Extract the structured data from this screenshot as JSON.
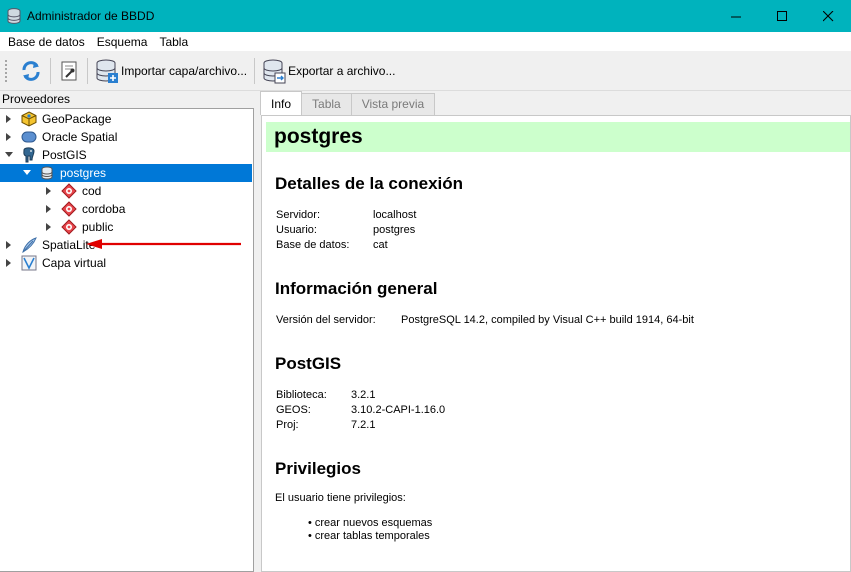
{
  "window": {
    "title": "Administrador de BBDD"
  },
  "menu": [
    {
      "label": "Base de datos"
    },
    {
      "label": "Esquema"
    },
    {
      "label": "Tabla"
    }
  ],
  "toolbar": {
    "refresh_icon": "refresh-icon",
    "info_icon": "properties-icon",
    "import_label": "Importar capa/archivo...",
    "export_label": "Exportar a archivo..."
  },
  "providers": {
    "header": "Proveedores",
    "items": [
      {
        "label": "GeoPackage",
        "icon": "geopackage-icon",
        "expanded": false
      },
      {
        "label": "Oracle Spatial",
        "icon": "oracle-icon",
        "expanded": false
      },
      {
        "label": "PostGIS",
        "icon": "postgis-elephant-icon",
        "expanded": true
      },
      {
        "label": "postgres",
        "icon": "database-icon",
        "expanded": true,
        "selected": true
      },
      {
        "label": "cod",
        "icon": "schema-icon",
        "expanded": false
      },
      {
        "label": "cordoba",
        "icon": "schema-icon",
        "expanded": false
      },
      {
        "label": "public",
        "icon": "schema-icon",
        "expanded": false
      },
      {
        "label": "SpatiaLite",
        "icon": "spatialite-icon",
        "expanded": false
      },
      {
        "label": "Capa virtual",
        "icon": "virtual-layer-icon",
        "expanded": false
      }
    ]
  },
  "tabs": [
    {
      "label": "Info",
      "active": true
    },
    {
      "label": "Tabla",
      "active": false
    },
    {
      "label": "Vista previa",
      "active": false
    }
  ],
  "info": {
    "title": "postgres",
    "connection": {
      "heading": "Detalles de la conexión",
      "rows": [
        {
          "key": "Servidor:",
          "value": "localhost"
        },
        {
          "key": "Usuario:",
          "value": "postgres"
        },
        {
          "key": "Base de datos:",
          "value": "cat"
        }
      ]
    },
    "general": {
      "heading": "Información general",
      "rows": [
        {
          "key": "Versión del servidor:",
          "value": "PostgreSQL 14.2, compiled by Visual C++ build 1914, 64-bit"
        }
      ]
    },
    "postgis": {
      "heading": "PostGIS",
      "rows": [
        {
          "key": "Biblioteca:",
          "value": "3.2.1"
        },
        {
          "key": "GEOS:",
          "value": "3.10.2-CAPI-1.16.0"
        },
        {
          "key": "Proj:",
          "value": "7.2.1"
        }
      ]
    },
    "privileges": {
      "heading": "Privilegios",
      "intro": "El usuario tiene privilegios:",
      "items": [
        "crear nuevos esquemas",
        "crear tablas temporales"
      ]
    }
  },
  "colors": {
    "titlebar": "#00b3bd",
    "selection": "#0078d7",
    "header_band": "#ccffcc",
    "annotation_arrow": "#e00000"
  }
}
